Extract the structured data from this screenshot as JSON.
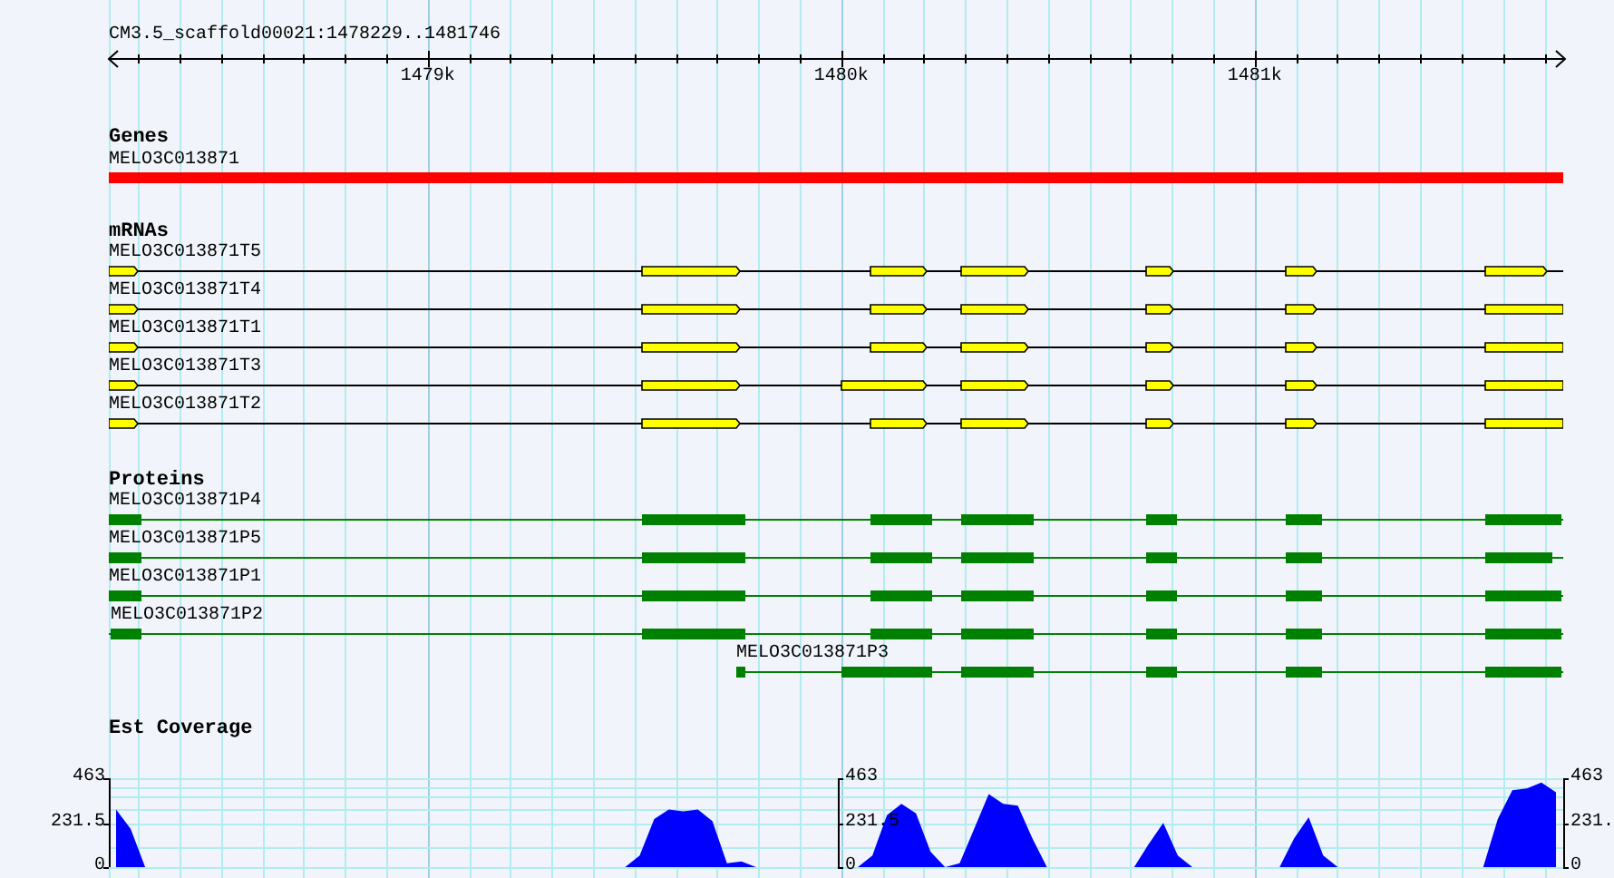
{
  "ruler": {
    "title": "CM3.5_scaffold00021:1478229..1481746",
    "labels": [
      "1479k",
      "1480k",
      "1481k"
    ]
  },
  "tracks": [
    {
      "kind": "genes",
      "title": "Genes",
      "features": [
        {
          "name": "MELO3C013871"
        }
      ]
    },
    {
      "kind": "mrnas",
      "title": "mRNAs",
      "features": [
        {
          "name": "MELO3C013871T5"
        },
        {
          "name": "MELO3C013871T4"
        },
        {
          "name": "MELO3C013871T1"
        },
        {
          "name": "MELO3C013871T3"
        },
        {
          "name": "MELO3C013871T2"
        }
      ]
    },
    {
      "kind": "proteins",
      "title": "Proteins",
      "features": [
        {
          "name": "MELO3C013871P4"
        },
        {
          "name": "MELO3C013871P5"
        },
        {
          "name": "MELO3C013871P1"
        },
        {
          "name": "MELO3C013871P2"
        },
        {
          "name": "MELO3C013871P3"
        }
      ]
    },
    {
      "kind": "coverage",
      "axes": [
        {
          "ticks": [
            "463",
            "231.5",
            "0"
          ]
        },
        {
          "ticks": [
            "463",
            "231.5",
            "0"
          ]
        },
        {
          "ticks": [
            "463",
            "231.",
            "0"
          ]
        }
      ],
      "chart_data": {
        "type": "area",
        "title": "Est Coverage",
        "ylim": [
          0,
          463
        ],
        "yticks": [
          0,
          231.5,
          463
        ],
        "series": [
          {
            "color": "#0000ff",
            "values": [
              300,
              200,
              0,
              0,
              0,
              0,
              0,
              0,
              0,
              0,
              0,
              0,
              0,
              0,
              0,
              0,
              0,
              0,
              0,
              0,
              0,
              0,
              0,
              0,
              0,
              0,
              0,
              0,
              0,
              0,
              0,
              0,
              0,
              0,
              0,
              0,
              60,
              250,
              300,
              290,
              300,
              240,
              20,
              30,
              0,
              0,
              0,
              0,
              0,
              0,
              0,
              0,
              60,
              270,
              330,
              280,
              80,
              0,
              20,
              200,
              380,
              330,
              320,
              150,
              0,
              0,
              0,
              0,
              0,
              0,
              0,
              120,
              230,
              60,
              0,
              0,
              0,
              0,
              0,
              0,
              0,
              150,
              260,
              60,
              0,
              0,
              0,
              0,
              0,
              0,
              0,
              0,
              0,
              0,
              0,
              250,
              400,
              410,
              440,
              390
            ]
          }
        ]
      }
    }
  ]
}
